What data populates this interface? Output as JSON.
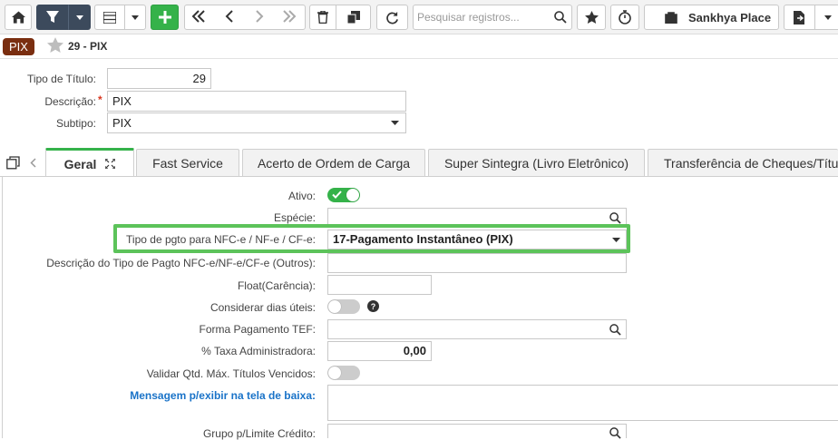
{
  "toolbar": {
    "search_placeholder": "Pesquisar registros...",
    "place_label": "Sankhya Place"
  },
  "titlebar": {
    "badge": "PIX",
    "title": "29 - PIX"
  },
  "header_form": {
    "tipo_titulo_label": "Tipo de Título:",
    "tipo_titulo_value": "29",
    "descricao_label": "Descrição:",
    "descricao_required": "*",
    "descricao_value": "PIX",
    "subtipo_label": "Subtipo:",
    "subtipo_value": "PIX"
  },
  "tabs": [
    {
      "label": "Geral"
    },
    {
      "label": "Fast Service"
    },
    {
      "label": "Acerto de Ordem de Carga"
    },
    {
      "label": "Super Sintegra (Livro Eletrônico)"
    },
    {
      "label": "Transferência de Cheques/Títu"
    }
  ],
  "form": {
    "ativo_label": "Ativo:",
    "especie_label": "Espécie:",
    "tipo_pgto_label": "Tipo de pgto para NFC-e / NF-e / CF-e:",
    "tipo_pgto_value": "17-Pagamento Instantâneo (PIX)",
    "descricao_tipo_label": "Descrição do Tipo de Pagto NFC-e/NF-e/CF-e (Outros):",
    "float_label": "Float(Carência):",
    "considerar_label": "Considerar dias úteis:",
    "forma_tef_label": "Forma Pagamento TEF:",
    "taxa_label": "% Taxa Administradora:",
    "taxa_value": "0,00",
    "validar_label": "Validar Qtd. Máx. Títulos Vencidos:",
    "mensagem_label": "Mensagem p/exibir na tela de baixa:",
    "grupo_label": "Grupo p/Limite Crédito:"
  },
  "colors": {
    "accent_green": "#35b24a",
    "badge_brown": "#7a2e10",
    "highlight_green": "#5cc35a",
    "link_blue": "#1a73c8"
  }
}
